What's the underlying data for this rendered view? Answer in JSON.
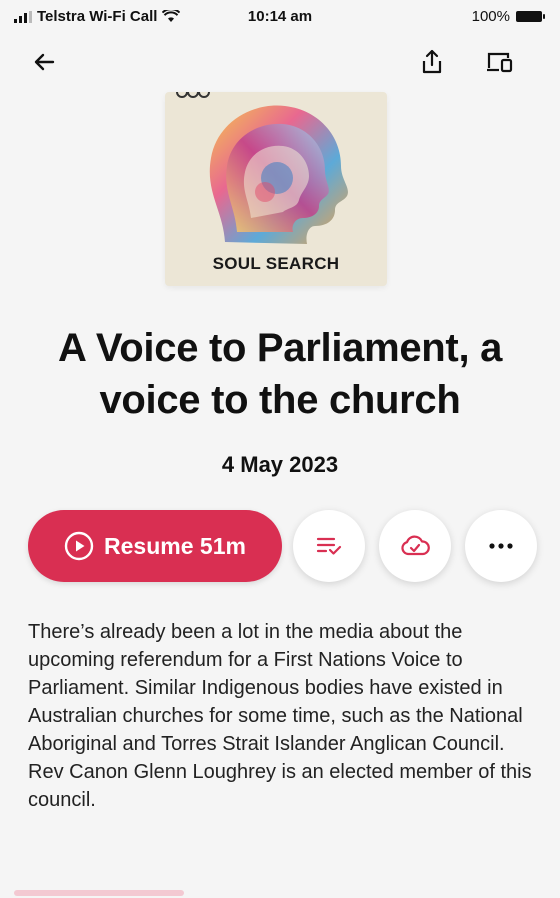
{
  "status_bar": {
    "carrier": "Telstra Wi-Fi Call",
    "time": "10:14 am",
    "battery": "100%"
  },
  "topbar": {
    "back_icon": "back-arrow-icon",
    "share_icon": "share-icon",
    "cast_icon": "cast-device-icon"
  },
  "artwork": {
    "caption": "SOUL SEARCH",
    "logo_icon": "abc-logo-icon"
  },
  "episode": {
    "title": "A Voice to Parliament, a voice to the church",
    "date": "4 May 2023"
  },
  "actions": {
    "resume_label": "Resume 51m",
    "queue_icon": "add-to-queue-icon",
    "download_icon": "cloud-download-icon",
    "more_icon": "more-options-icon"
  },
  "description": "There’s already been a lot in the media about the upcoming referendum for a First Nations Voice to Parliament. Similar Indigenous bodies have existed in Australian churches for some time, such as the National Aboriginal and Torres Strait Islander Anglican Council. Rev Canon Glenn Loughrey is an elected member of this council.",
  "colors": {
    "accent": "#d92f52",
    "background": "#f5f5f5"
  }
}
